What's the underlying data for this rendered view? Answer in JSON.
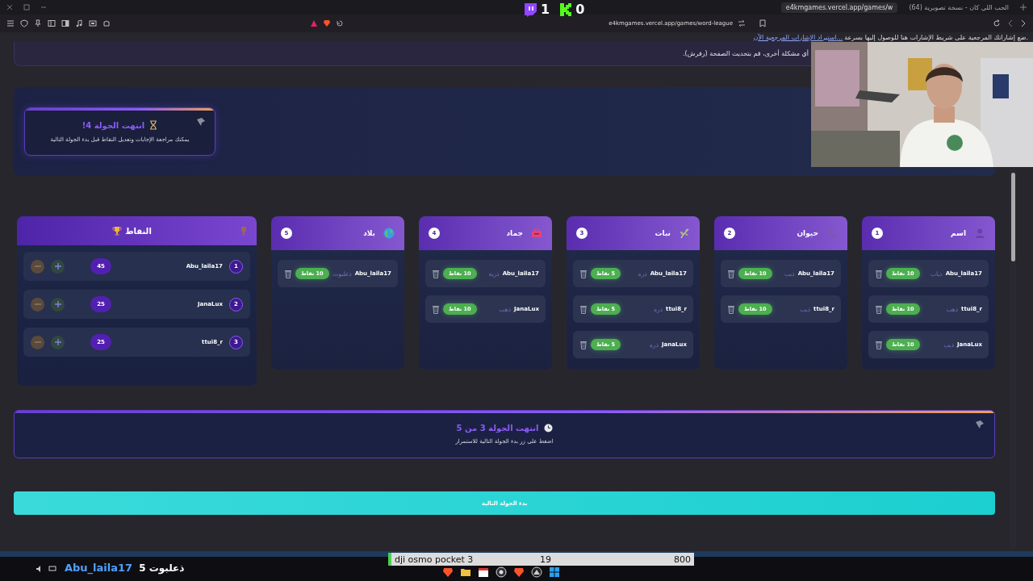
{
  "browser": {
    "tabs": [
      {
        "title": "(64) الحب اللي كان - نسخة تصويرية",
        "selected": false
      },
      {
        "title": "e4kmgames.vercel.app/games/w",
        "selected": true
      }
    ],
    "url": "e4kmgames.vercel.app/games/word-league",
    "bookmarks_hint": "ضع إشاراتك المرجعية على شريط الإشارات هنا للوصول إليها بسرعة.",
    "bookmarks_link": "استيراد الإشارات المرجعية الآن..."
  },
  "stream_counters": [
    {
      "kind": "kick",
      "count": "0"
    },
    {
      "kind": "twitch",
      "count": "1"
    }
  ],
  "notice": "أي مشكلة أخرى، قم بتحديث الصفحة (رفرش).",
  "round_card": {
    "title": "انتهت الجولة 4!",
    "subtitle": "يمكنك مراجعة الإجابات وتعديل النقاط قبل بدء الجولة التالية"
  },
  "categories": [
    {
      "name": "اسم",
      "number": "1",
      "answers": [
        {
          "player": "Abu_laila17",
          "answer": "ذياب",
          "points": "10 نقاط"
        },
        {
          "player": "ttui8_r",
          "answer": "ذهب",
          "points": "10 نقاط"
        },
        {
          "player": "JanaLux",
          "answer": "ذيب",
          "points": "10 نقاط"
        }
      ]
    },
    {
      "name": "حيوان",
      "number": "2",
      "answers": [
        {
          "player": "Abu_laila17",
          "answer": "ذيب",
          "points": "10 نقاط"
        },
        {
          "player": "ttui8_r",
          "answer": "ذيب",
          "points": "10 نقاط"
        }
      ]
    },
    {
      "name": "نبات",
      "number": "3",
      "answers": [
        {
          "player": "Abu_laila17",
          "answer": "ذره",
          "points": "5 نقاط"
        },
        {
          "player": "ttui8_r",
          "answer": "ذره",
          "points": "5 نقاط"
        },
        {
          "player": "JanaLux",
          "answer": "ذره",
          "points": "5 نقاط"
        }
      ]
    },
    {
      "name": "جماد",
      "number": "4",
      "answers": [
        {
          "player": "Abu_laila17",
          "answer": "ذرية",
          "points": "10 نقاط"
        },
        {
          "player": "JanaLux",
          "answer": "ذهب",
          "points": "10 نقاط"
        }
      ]
    },
    {
      "name": "بلاد",
      "number": "5",
      "answers": [
        {
          "player": "Abu_laila17",
          "answer": "ذعلبوت",
          "points": "10 نقاط"
        }
      ]
    }
  ],
  "scoreboard": {
    "title": "النقاط",
    "players": [
      {
        "rank": "1",
        "name": "Abu_laila17",
        "score": "45"
      },
      {
        "rank": "2",
        "name": "JanaLux",
        "score": "25"
      },
      {
        "rank": "3",
        "name": "ttui8_r",
        "score": "25"
      }
    ]
  },
  "round_banner": {
    "title": "انتهت الجولة 3 من 5",
    "subtitle": "اضغط على زر بدء الجولة التالية للاستمرار"
  },
  "next_button": "بدء الجولة التالية",
  "overlay": {
    "chat_text": "ذعلبوت 5",
    "chat_user": "Abu_laila17",
    "product": "dji osmo pocket 3",
    "product_count": "19",
    "product_value": "800"
  }
}
